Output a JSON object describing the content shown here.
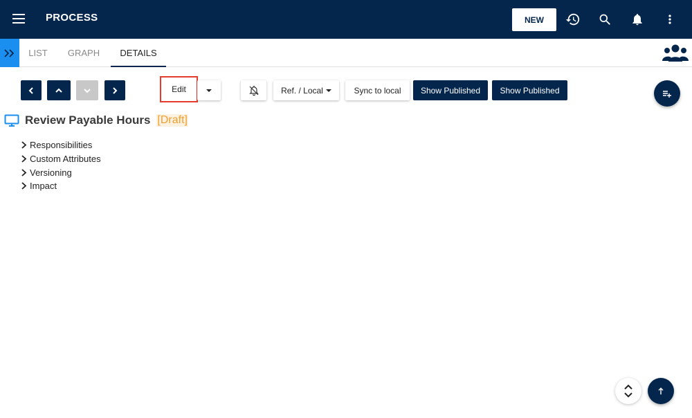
{
  "header": {
    "title": "PROCESS",
    "new_label": "NEW",
    "icons": [
      "menu-icon",
      "history-icon",
      "search-icon",
      "bell-icon",
      "more-vert-icon"
    ]
  },
  "tabs": [
    {
      "label": "LIST",
      "active": false
    },
    {
      "label": "GRAPH",
      "active": false
    },
    {
      "label": "DETAILS",
      "active": true
    }
  ],
  "toolbar": {
    "edit_label": "Edit",
    "ref_local_label": "Ref. / Local",
    "sync_label": "Sync to local",
    "show_published_1": "Show Published",
    "show_published_2": "Show Published"
  },
  "details": {
    "title": "Review Payable Hours",
    "status": "[Draft]",
    "sections": [
      "Responsibilities",
      "Custom Attributes",
      "Versioning",
      "Impact"
    ]
  },
  "colors": {
    "primary": "#04264d",
    "accent": "#1a8ff0",
    "draft": "#f0a030",
    "highlight_border": "#e53b2c"
  }
}
